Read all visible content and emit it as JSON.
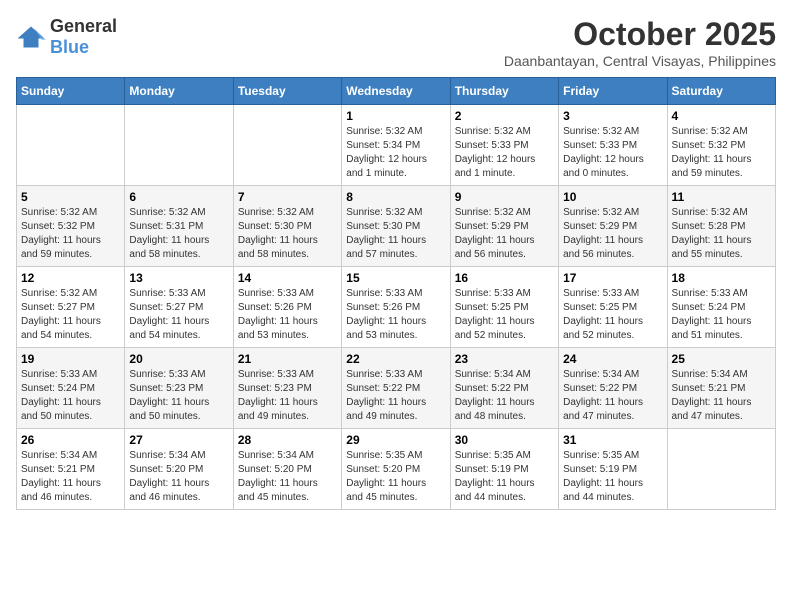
{
  "logo": {
    "general": "General",
    "blue": "Blue"
  },
  "header": {
    "month": "October 2025",
    "location": "Daanbantayan, Central Visayas, Philippines"
  },
  "days_of_week": [
    "Sunday",
    "Monday",
    "Tuesday",
    "Wednesday",
    "Thursday",
    "Friday",
    "Saturday"
  ],
  "weeks": [
    [
      {
        "day": "",
        "info": ""
      },
      {
        "day": "",
        "info": ""
      },
      {
        "day": "",
        "info": ""
      },
      {
        "day": "1",
        "info": "Sunrise: 5:32 AM\nSunset: 5:34 PM\nDaylight: 12 hours\nand 1 minute."
      },
      {
        "day": "2",
        "info": "Sunrise: 5:32 AM\nSunset: 5:33 PM\nDaylight: 12 hours\nand 1 minute."
      },
      {
        "day": "3",
        "info": "Sunrise: 5:32 AM\nSunset: 5:33 PM\nDaylight: 12 hours\nand 0 minutes."
      },
      {
        "day": "4",
        "info": "Sunrise: 5:32 AM\nSunset: 5:32 PM\nDaylight: 11 hours\nand 59 minutes."
      }
    ],
    [
      {
        "day": "5",
        "info": "Sunrise: 5:32 AM\nSunset: 5:32 PM\nDaylight: 11 hours\nand 59 minutes."
      },
      {
        "day": "6",
        "info": "Sunrise: 5:32 AM\nSunset: 5:31 PM\nDaylight: 11 hours\nand 58 minutes."
      },
      {
        "day": "7",
        "info": "Sunrise: 5:32 AM\nSunset: 5:30 PM\nDaylight: 11 hours\nand 58 minutes."
      },
      {
        "day": "8",
        "info": "Sunrise: 5:32 AM\nSunset: 5:30 PM\nDaylight: 11 hours\nand 57 minutes."
      },
      {
        "day": "9",
        "info": "Sunrise: 5:32 AM\nSunset: 5:29 PM\nDaylight: 11 hours\nand 56 minutes."
      },
      {
        "day": "10",
        "info": "Sunrise: 5:32 AM\nSunset: 5:29 PM\nDaylight: 11 hours\nand 56 minutes."
      },
      {
        "day": "11",
        "info": "Sunrise: 5:32 AM\nSunset: 5:28 PM\nDaylight: 11 hours\nand 55 minutes."
      }
    ],
    [
      {
        "day": "12",
        "info": "Sunrise: 5:32 AM\nSunset: 5:27 PM\nDaylight: 11 hours\nand 54 minutes."
      },
      {
        "day": "13",
        "info": "Sunrise: 5:33 AM\nSunset: 5:27 PM\nDaylight: 11 hours\nand 54 minutes."
      },
      {
        "day": "14",
        "info": "Sunrise: 5:33 AM\nSunset: 5:26 PM\nDaylight: 11 hours\nand 53 minutes."
      },
      {
        "day": "15",
        "info": "Sunrise: 5:33 AM\nSunset: 5:26 PM\nDaylight: 11 hours\nand 53 minutes."
      },
      {
        "day": "16",
        "info": "Sunrise: 5:33 AM\nSunset: 5:25 PM\nDaylight: 11 hours\nand 52 minutes."
      },
      {
        "day": "17",
        "info": "Sunrise: 5:33 AM\nSunset: 5:25 PM\nDaylight: 11 hours\nand 52 minutes."
      },
      {
        "day": "18",
        "info": "Sunrise: 5:33 AM\nSunset: 5:24 PM\nDaylight: 11 hours\nand 51 minutes."
      }
    ],
    [
      {
        "day": "19",
        "info": "Sunrise: 5:33 AM\nSunset: 5:24 PM\nDaylight: 11 hours\nand 50 minutes."
      },
      {
        "day": "20",
        "info": "Sunrise: 5:33 AM\nSunset: 5:23 PM\nDaylight: 11 hours\nand 50 minutes."
      },
      {
        "day": "21",
        "info": "Sunrise: 5:33 AM\nSunset: 5:23 PM\nDaylight: 11 hours\nand 49 minutes."
      },
      {
        "day": "22",
        "info": "Sunrise: 5:33 AM\nSunset: 5:22 PM\nDaylight: 11 hours\nand 49 minutes."
      },
      {
        "day": "23",
        "info": "Sunrise: 5:34 AM\nSunset: 5:22 PM\nDaylight: 11 hours\nand 48 minutes."
      },
      {
        "day": "24",
        "info": "Sunrise: 5:34 AM\nSunset: 5:22 PM\nDaylight: 11 hours\nand 47 minutes."
      },
      {
        "day": "25",
        "info": "Sunrise: 5:34 AM\nSunset: 5:21 PM\nDaylight: 11 hours\nand 47 minutes."
      }
    ],
    [
      {
        "day": "26",
        "info": "Sunrise: 5:34 AM\nSunset: 5:21 PM\nDaylight: 11 hours\nand 46 minutes."
      },
      {
        "day": "27",
        "info": "Sunrise: 5:34 AM\nSunset: 5:20 PM\nDaylight: 11 hours\nand 46 minutes."
      },
      {
        "day": "28",
        "info": "Sunrise: 5:34 AM\nSunset: 5:20 PM\nDaylight: 11 hours\nand 45 minutes."
      },
      {
        "day": "29",
        "info": "Sunrise: 5:35 AM\nSunset: 5:20 PM\nDaylight: 11 hours\nand 45 minutes."
      },
      {
        "day": "30",
        "info": "Sunrise: 5:35 AM\nSunset: 5:19 PM\nDaylight: 11 hours\nand 44 minutes."
      },
      {
        "day": "31",
        "info": "Sunrise: 5:35 AM\nSunset: 5:19 PM\nDaylight: 11 hours\nand 44 minutes."
      },
      {
        "day": "",
        "info": ""
      }
    ]
  ]
}
